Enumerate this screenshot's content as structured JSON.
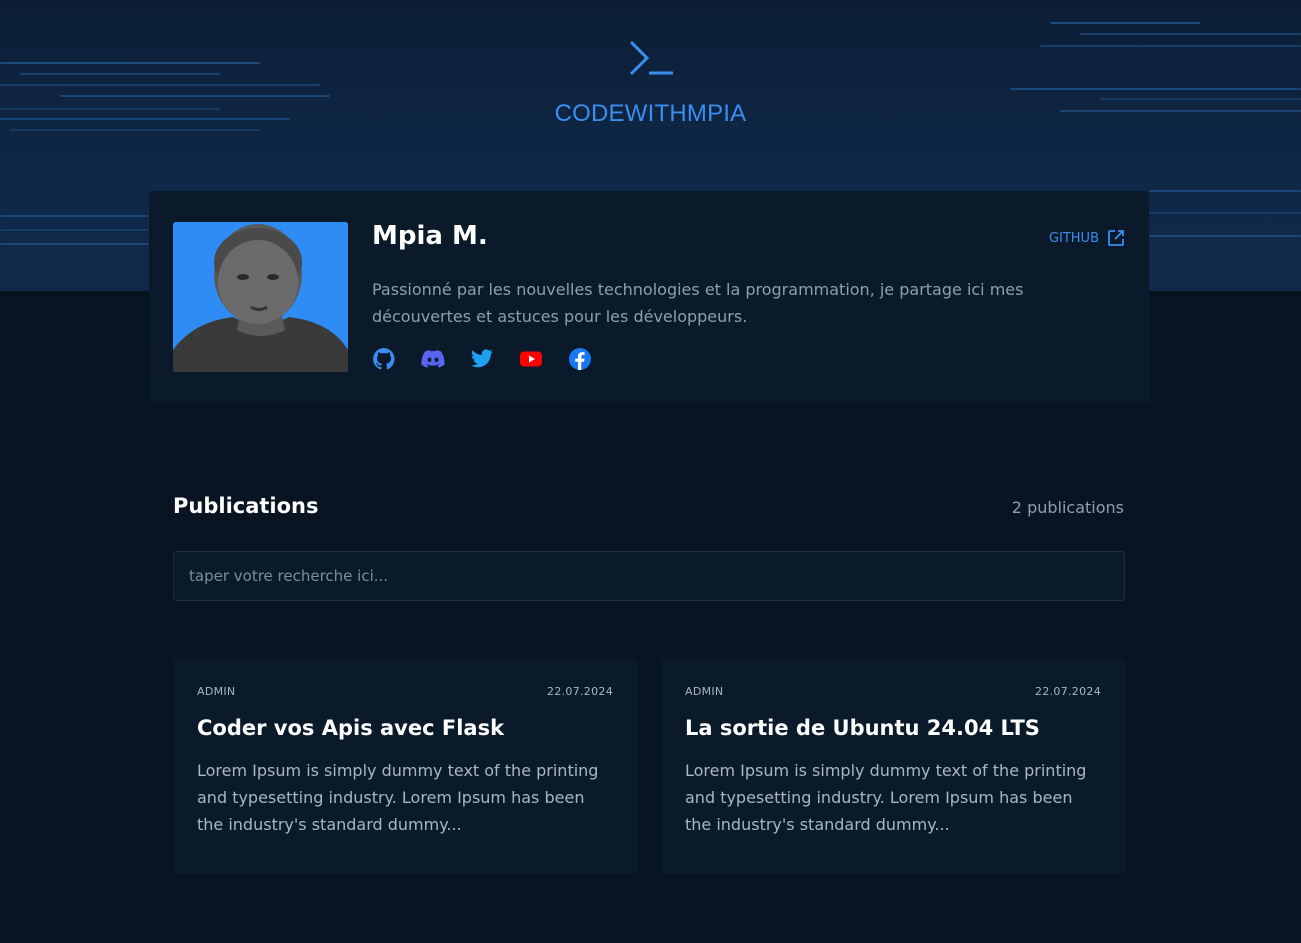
{
  "header": {
    "brand": "CODEWITHMPIA",
    "logo_icon": "terminal-prompt-icon"
  },
  "profile": {
    "name": "Mpia M.",
    "bio": "Passionné par les nouvelles technologies et la programmation, je partage ici mes découvertes et astuces pour les développeurs.",
    "github_label": "GITHUB",
    "github_icon": "external-link-icon",
    "socials": [
      {
        "name": "github-icon",
        "color": "#3b8ef0"
      },
      {
        "name": "discord-icon",
        "color": "#5865f2"
      },
      {
        "name": "twitter-icon",
        "color": "#1da1f2"
      },
      {
        "name": "youtube-icon",
        "color": "#ff0000"
      },
      {
        "name": "facebook-icon",
        "color": "#1877f2"
      }
    ]
  },
  "publications": {
    "title": "Publications",
    "count": "2 publications",
    "search_placeholder": "taper votre recherche ici...",
    "posts": [
      {
        "author": "ADMIN",
        "date": "22.07.2024",
        "title": "Coder vos Apis avec Flask",
        "excerpt": "Lorem Ipsum is simply dummy text of the printing and typesetting industry. Lorem Ipsum has been the industry's standard dummy..."
      },
      {
        "author": "ADMIN",
        "date": "22.07.2024",
        "title": "La sortie de Ubuntu 24.04 LTS",
        "excerpt": "Lorem Ipsum is simply dummy text of the printing and typesetting industry. Lorem Ipsum has been the industry's standard dummy..."
      }
    ]
  },
  "colors": {
    "accent": "#3b8ef0",
    "background": "#081422",
    "card": "#0b1a2b"
  }
}
